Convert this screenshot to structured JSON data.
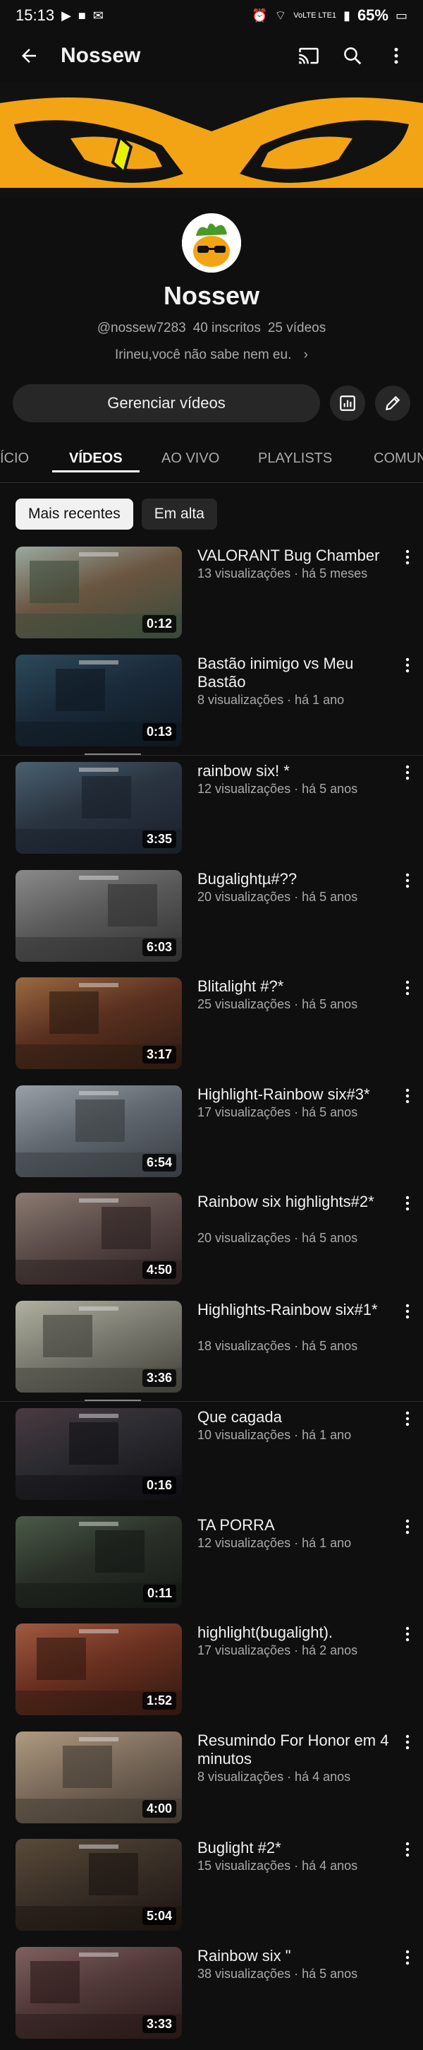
{
  "status": {
    "time": "15:13",
    "network": "VoLTE LTE1",
    "battery": "65%"
  },
  "appbar": {
    "title": "Nossew"
  },
  "channel": {
    "name": "Nossew",
    "handle": "@nossew7283",
    "subscribers": "40 inscritos",
    "videos_count": "25 vídeos",
    "description": "Irineu,você não sabe nem eu."
  },
  "actions": {
    "manage_label": "Gerenciar vídeos"
  },
  "tabs": [
    {
      "label": "ÍCIO"
    },
    {
      "label": "VÍDEOS"
    },
    {
      "label": "AO VIVO"
    },
    {
      "label": "PLAYLISTS"
    },
    {
      "label": "COMUN"
    }
  ],
  "chips": [
    {
      "label": "Mais recentes"
    },
    {
      "label": "Em alta"
    }
  ],
  "videos": [
    {
      "title": "VALORANT Bug Chamber",
      "meta": "13 visualizações · há 5 meses",
      "duration": "0:12",
      "colors": [
        "#6a5540",
        "#9aa9a0",
        "#3a4a3a"
      ]
    },
    {
      "title": "Bastão inimigo vs Meu Bastão",
      "meta": "8 visualizações · há 1 ano",
      "duration": "0:13",
      "colors": [
        "#1a2a3a",
        "#2c4a5a",
        "#0d1820"
      ]
    },
    {
      "title": "rainbow six! *",
      "meta": "12 visualizações · há 5 anos",
      "duration": "3:35",
      "colors": [
        "#2a3440",
        "#4a6070",
        "#18202a"
      ]
    },
    {
      "title": "Bugalightµ#??",
      "meta": "20 visualizações · há 5 anos",
      "duration": "6:03",
      "colors": [
        "#5a5a5a",
        "#8a8a8a",
        "#303030"
      ]
    },
    {
      "title": "Blitalight #?*",
      "meta": "25 visualizações · há 5 anos",
      "duration": "3:17",
      "colors": [
        "#5a3020",
        "#9a6a40",
        "#2a1a10"
      ]
    },
    {
      "title": "Highlight-Rainbow six#3*",
      "meta": "17 visualizações · há 5 anos",
      "duration": "6:54",
      "colors": [
        "#606870",
        "#9aa0a8",
        "#383c40"
      ]
    },
    {
      "title": "Rainbow six highlights#2*",
      "meta": "20 visualizações · há 5 anos",
      "duration": "4:50",
      "colors": [
        "#5a4a48",
        "#8a7a70",
        "#2a2020"
      ]
    },
    {
      "title": "Highlights-Rainbow six#1*",
      "meta": "18 visualizações · há 5 anos",
      "duration": "3:36",
      "colors": [
        "#7a7a70",
        "#b0b0a0",
        "#404038"
      ]
    },
    {
      "title": "Que cagada",
      "meta": "10 visualizações · há 1 ano",
      "duration": "0:16",
      "colors": [
        "#2a2a30",
        "#4a3a40",
        "#101014"
      ]
    },
    {
      "title": "TA PORRA",
      "meta": "12 visualizações · há 1 ano",
      "duration": "0:11",
      "colors": [
        "#2a3028",
        "#4a5a48",
        "#141814"
      ]
    },
    {
      "title": "highlight(bugalight).",
      "meta": "17 visualizações · há 2 anos",
      "duration": "1:52",
      "colors": [
        "#6a3020",
        "#a05a40",
        "#301810"
      ]
    },
    {
      "title": "Resumindo For Honor em 4 minutos",
      "meta": "8 visualizações · há 4 anos",
      "duration": "4:00",
      "colors": [
        "#7a6a5a",
        "#b09a80",
        "#403830"
      ]
    },
    {
      "title": "Buglight #2*",
      "meta": "15 visualizações · há 4 anos",
      "duration": "5:04",
      "colors": [
        "#3a3028",
        "#5a4a38",
        "#1a1410"
      ]
    },
    {
      "title": "Rainbow six \"",
      "meta": "38 visualizações · há 5 anos",
      "duration": "3:33",
      "colors": [
        "#503838",
        "#806060",
        "#281818"
      ]
    }
  ],
  "icons": {
    "back": "arrow-left-icon",
    "cast": "cast-icon",
    "search": "search-icon",
    "more": "more-vert-icon",
    "stats": "analytics-icon",
    "edit": "pencil-icon"
  }
}
